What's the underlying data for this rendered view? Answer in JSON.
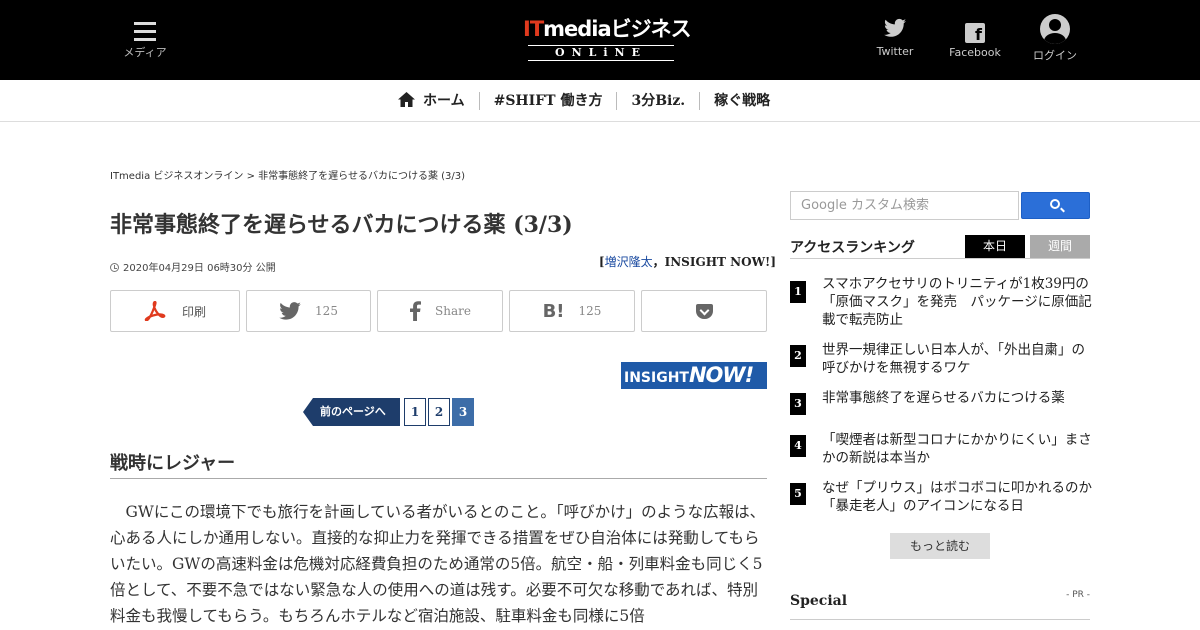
{
  "header": {
    "menu_label": "メディア",
    "logo_main_it": "IT",
    "logo_main_rest": "mediaビジネス",
    "logo_sub": "ONLiNE",
    "twitter_label": "Twitter",
    "facebook_label": "Facebook",
    "login_label": "ログイン"
  },
  "nav": {
    "items": [
      {
        "label": "ホーム"
      },
      {
        "label": "#SHIFT 働き方"
      },
      {
        "label": "3分Biz."
      },
      {
        "label": "稼ぐ戦略"
      }
    ]
  },
  "article": {
    "breadcrumb_root": "ITmedia ビジネスオンライン",
    "breadcrumb_sep": " > ",
    "breadcrumb_current": "非常事態終了を遅らせるバカにつける薬 (3/3)",
    "title": "非常事態終了を遅らせるバカにつける薬 (3/3)",
    "date": "2020年04月29日 06時30分 公開",
    "byline_open": "[",
    "author": "増沢隆太",
    "byline_rest": "，INSIGHT NOW!]",
    "share": {
      "print_label": "印刷",
      "twitter_count": "125",
      "facebook_label": "Share",
      "hatena_count": "125"
    },
    "insight_logo_a": "INSIGHT",
    "insight_logo_b": "NOW!",
    "pager": {
      "prev_label": "前のページへ",
      "pages": [
        "1",
        "2",
        "3"
      ],
      "current": 3
    },
    "section_heading": "戦時にレジャー",
    "body": "GWにこの環境下でも旅行を計画している者がいるとのこと。「呼びかけ」のような広報は、心ある人にしか通用しない。直接的な抑止力を発揮できる措置をぜひ自治体には発動してもらいたい。GWの高速料金は危機対応経費負担のため通常の5倍。航空・船・列車料金も同じく5倍として、不要不急ではない緊急な人の使用への道は残す。必要不可欠な移動であれば、特別料金も我慢してもらう。もちろんホテルなど宿泊施設、駐車料金も同様に5倍"
  },
  "sidebar": {
    "search_placeholder": "Google カスタム検索",
    "ranking_title": "アクセスランキング",
    "tab_today": "本日",
    "tab_week": "週間",
    "ranking": [
      {
        "num": "1",
        "text": "スマホアクセサリのトリニティが1枚39円の「原価マスク」を発売　パッケージに原価記載で転売防止"
      },
      {
        "num": "2",
        "text": "世界一規律正しい日本人が、「外出自粛」の呼びかけを無視するワケ"
      },
      {
        "num": "3",
        "text": "非常事態終了を遅らせるバカにつける薬"
      },
      {
        "num": "4",
        "text": "「喫煙者は新型コロナにかかりにくい」まさかの新説は本当か"
      },
      {
        "num": "5",
        "text": "なぜ「プリウス」はボコボコに叩かれるのか　「暴走老人」のアイコンになる日"
      }
    ],
    "more_label": "もっと読む",
    "special_title": "Special",
    "pr_label": "- PR -"
  },
  "colors": {
    "header_bg": "#000000",
    "logo_accent": "#e03a1e",
    "pager_dark": "#1e3d6b",
    "pager_current": "#3d6da8",
    "search_button": "#2b6fd8",
    "insight_blue": "#1f5aa8"
  }
}
